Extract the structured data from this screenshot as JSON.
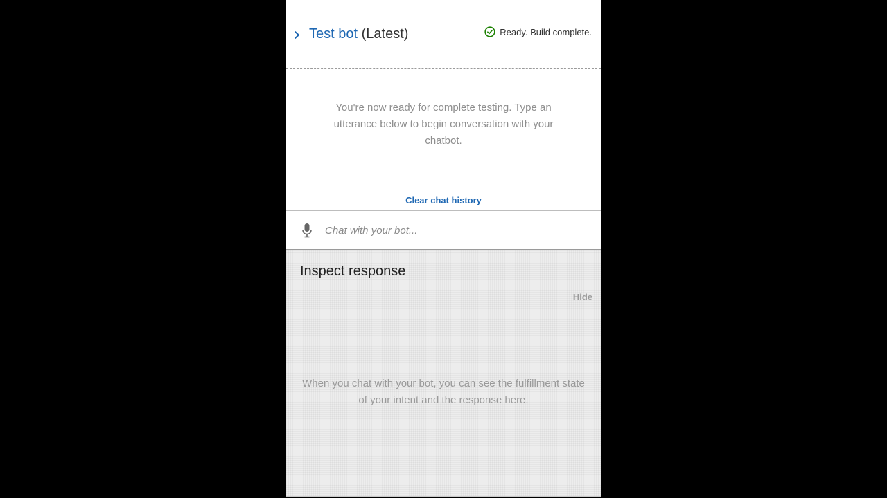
{
  "header": {
    "bot_name": "Test bot",
    "version": "(Latest)",
    "status_text": "Ready. Build complete.",
    "expand_icon": "chevron-right-icon",
    "status_icon": "check-circle-icon"
  },
  "chat": {
    "intro_text": "You're now ready for complete testing. Type an utterance below to begin conversation with your chatbot.",
    "clear_history_label": "Clear chat history",
    "input_placeholder": "Chat with your bot...",
    "input_value": "",
    "mic_icon": "microphone-icon"
  },
  "inspect": {
    "title": "Inspect response",
    "hide_label": "Hide",
    "empty_text": "When you chat with your bot, you can see the fulfillment state of your intent and the response here."
  },
  "colors": {
    "link_blue": "#1f68b3",
    "success_green": "#1d8102",
    "muted_text": "#8e8e8e",
    "background": "#000000",
    "inspect_bg": "#ededed"
  }
}
